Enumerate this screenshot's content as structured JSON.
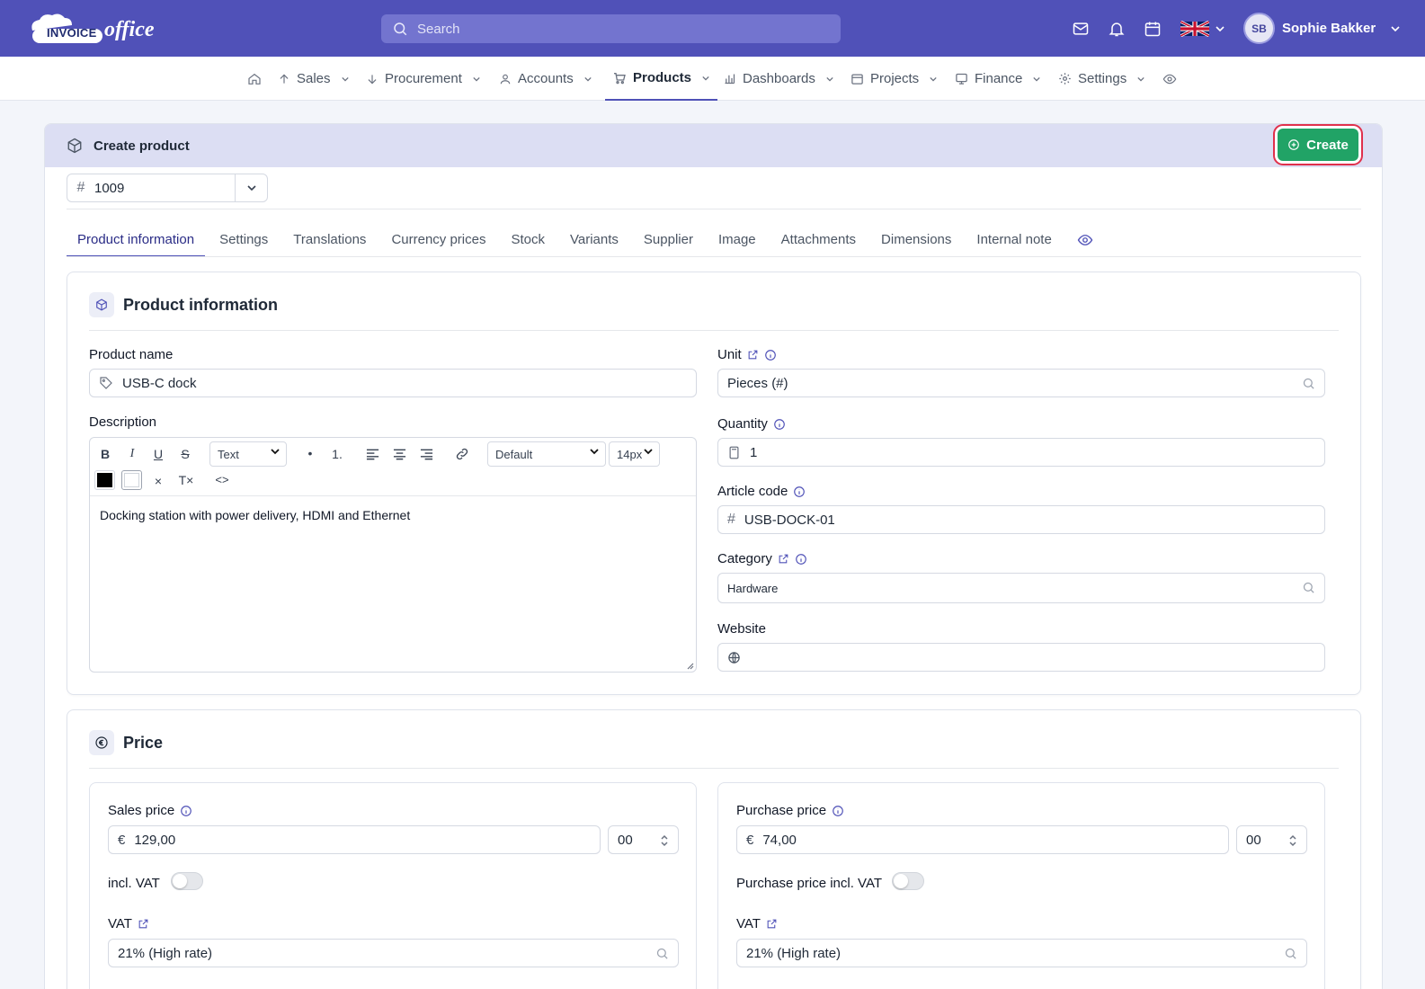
{
  "topbar": {
    "logo_text_1": "INVOICE",
    "logo_text_2": "office",
    "search_placeholder": "Search",
    "user_initials": "SB",
    "user_name": "Sophie Bakker"
  },
  "nav": {
    "items": [
      {
        "label": "Sales"
      },
      {
        "label": "Procurement"
      },
      {
        "label": "Accounts"
      },
      {
        "label": "Products"
      },
      {
        "label": "Dashboards"
      },
      {
        "label": "Projects"
      },
      {
        "label": "Finance"
      },
      {
        "label": "Settings"
      }
    ],
    "active": "Products"
  },
  "header": {
    "title": "Create product",
    "create_label": "Create",
    "number": "1009"
  },
  "tabs": [
    "Product information",
    "Settings",
    "Translations",
    "Currency prices",
    "Stock",
    "Variants",
    "Supplier",
    "Image",
    "Attachments",
    "Dimensions",
    "Internal note"
  ],
  "product_info": {
    "title": "Product information",
    "product_name_label": "Product name",
    "product_name": "USB-C dock",
    "description_label": "Description",
    "description": "Docking station with power delivery, HDMI and Ethernet",
    "editor": {
      "bold": "B",
      "italic": "I",
      "underline": "U",
      "strike": "S",
      "format": "Text",
      "bullet": "•",
      "ordered": "1.",
      "font": "Default",
      "size": "14px",
      "clear": "×",
      "clear_format": "T×",
      "code": "<>",
      "text_color": "#000000",
      "bg_color": "#ffffff"
    },
    "unit_label": "Unit",
    "unit": "Pieces (#)",
    "quantity_label": "Quantity",
    "quantity": "1",
    "article_code_label": "Article code",
    "article_code": "USB-DOCK-01",
    "category_label": "Category",
    "category": "Hardware",
    "website_label": "Website",
    "website": ""
  },
  "price": {
    "title": "Price",
    "sales": {
      "label": "Sales price",
      "currency": "€",
      "value": "129,00",
      "decimals": "00",
      "incl_vat_label": "incl. VAT",
      "incl_vat": false,
      "vat_label": "VAT",
      "vat": "21% (High rate)"
    },
    "purchase": {
      "label": "Purchase price",
      "currency": "€",
      "value": "74,00",
      "decimals": "00",
      "incl_vat_label": "Purchase price incl. VAT",
      "incl_vat": false,
      "vat_label": "VAT",
      "vat": "21% (High rate)"
    }
  },
  "colors": {
    "brand": "#5051b8",
    "create": "#21a366",
    "create_outline": "#e0304c"
  }
}
